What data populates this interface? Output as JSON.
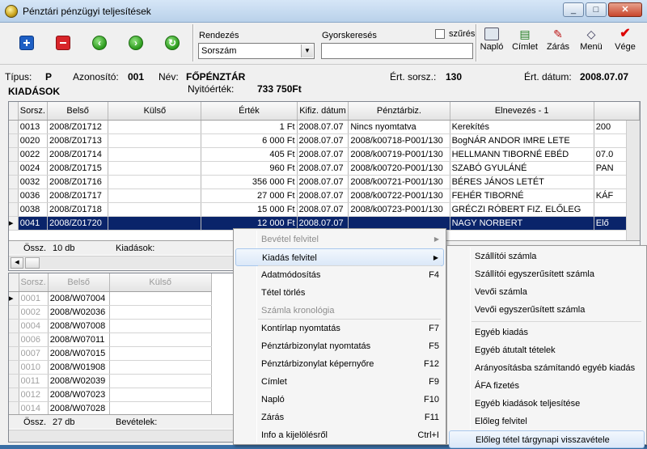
{
  "window": {
    "title": "Pénztári pénzügyi teljesítések",
    "min": "_",
    "max": "□",
    "close": "✕"
  },
  "toolbar": {
    "rendezes_label": "Rendezés",
    "rendezes_value": "Sorszám",
    "gyorskereses_label": "Gyorskeresés",
    "gyorskereses_value": "",
    "szures_label": "szűrés",
    "naplo": "Napló",
    "cimlet": "Címlet",
    "zaras": "Zárás",
    "menu": "Menü",
    "vege": "Vége"
  },
  "info": {
    "tipus_label": "Típus:",
    "tipus_value": "P",
    "azonosito_label": "Azonosító:",
    "azonosito_value": "001",
    "nev_label": "Név:",
    "nev_value": "FŐPÉNZTÁR",
    "ert_sorsz_label": "Ért. sorsz.:",
    "ert_sorsz_value": "130",
    "ert_datum_label": "Ért. dátum:",
    "ert_datum_value": "2008.07.07",
    "section": "KIADÁSOK",
    "nyito_label": "Nyitóérték:",
    "nyito_value": "733 750Ft"
  },
  "upper_grid": {
    "headers": [
      "Sorsz.",
      "Belső",
      "Külső",
      "Érték",
      "Kifiz. dátum",
      "Pénztárbiz.",
      "Elnevezés - 1",
      ""
    ],
    "rows": [
      [
        "0013",
        "2008/Z01712",
        "",
        "1 Ft",
        "2008.07.07",
        "Nincs nyomtatva",
        "Kerekítés",
        "200"
      ],
      [
        "0020",
        "2008/Z01713",
        "",
        "6 000 Ft",
        "2008.07.07",
        "2008/k00718-P001/130",
        "BogNÁR ANDOR IMRE        LETE",
        ""
      ],
      [
        "0022",
        "2008/Z01714",
        "",
        "405 Ft",
        "2008.07.07",
        "2008/k00719-P001/130",
        "HELLMANN TIBORNÉ EBÉD",
        "07.0"
      ],
      [
        "0024",
        "2008/Z01715",
        "",
        "960 Ft",
        "2008.07.07",
        "2008/k00720-P001/130",
        "SZABÓ GYULÁNÉ",
        "PAN"
      ],
      [
        "0032",
        "2008/Z01716",
        "",
        "356 000 Ft",
        "2008.07.07",
        "2008/k00721-P001/130",
        "BÉRES JÁNOS LETÉT",
        ""
      ],
      [
        "0036",
        "2008/Z01717",
        "",
        "27 000 Ft",
        "2008.07.07",
        "2008/k00722-P001/130",
        "FEHÉR TIBORNÉ",
        "KÁF"
      ],
      [
        "0038",
        "2008/Z01718",
        "",
        "15 000 Ft",
        "2008.07.07",
        "2008/k00723-P001/130",
        "GRÉCZI RÓBERT  FIZ. ELŐLEG",
        ""
      ],
      [
        "0041",
        "2008/Z01720",
        "",
        "12 000 Ft",
        "2008.07.07",
        "",
        "NAGY  NORBERT",
        "Elő"
      ]
    ],
    "footer": {
      "ossz_label": "Össz.",
      "count": "10 db",
      "kiadasok_label": "Kiadások:"
    }
  },
  "lower_grid": {
    "headers": [
      "Sorsz.",
      "Belső",
      "Külső"
    ],
    "rows": [
      [
        "0001",
        "2008/W07004",
        ""
      ],
      [
        "0002",
        "2008/W02036",
        ""
      ],
      [
        "0004",
        "2008/W07008",
        ""
      ],
      [
        "0006",
        "2008/W07011",
        ""
      ],
      [
        "0007",
        "2008/W07015",
        ""
      ],
      [
        "0010",
        "2008/W01908",
        ""
      ],
      [
        "0011",
        "2008/W02039",
        ""
      ],
      [
        "0012",
        "2008/W07023",
        ""
      ],
      [
        "0014",
        "2008/W07028",
        ""
      ]
    ],
    "footer": {
      "ossz_label": "Össz.",
      "count": "27 db",
      "bevetelek_label": "Bevételek:"
    }
  },
  "context_menu": {
    "items": [
      {
        "label": "Bevétel felvitel",
        "key": "",
        "disabled": true,
        "sub": true
      },
      {
        "label": "Kiadás felvitel",
        "key": "",
        "disabled": false,
        "sub": true
      },
      {
        "label": "Adatmódosítás",
        "key": "F4",
        "disabled": false
      },
      {
        "label": "Tétel törlés",
        "key": "",
        "disabled": false
      },
      {
        "label": "Számla kronológia",
        "key": "",
        "disabled": true
      },
      {
        "label": "Kontírlap nyomtatás",
        "key": "F7",
        "disabled": false
      },
      {
        "label": "Pénztárbizonylat nyomtatás",
        "key": "F5",
        "disabled": false
      },
      {
        "label": "Pénztárbizonylat képernyőre",
        "key": "F12",
        "disabled": false
      },
      {
        "label": "Címlet",
        "key": "F9",
        "disabled": false
      },
      {
        "label": "Napló",
        "key": "F10",
        "disabled": false
      },
      {
        "label": "Zárás",
        "key": "F11",
        "disabled": false
      },
      {
        "label": "Info a kijelölésről",
        "key": "Ctrl+I",
        "disabled": false
      }
    ]
  },
  "submenu": {
    "items": [
      "Szállítói számla",
      "Szállítói egyszerűsített számla",
      "Vevői számla",
      "Vevői egyszerűsített számla",
      "Egyéb kiadás",
      "Egyéb átutalt tételek",
      "Arányosításba számítandó egyéb kiadás",
      "ÁFA fizetés",
      "Egyéb kiadások teljesítése",
      "Előleg felvitel",
      "Előleg tétel tárgynapi visszavétele"
    ]
  }
}
